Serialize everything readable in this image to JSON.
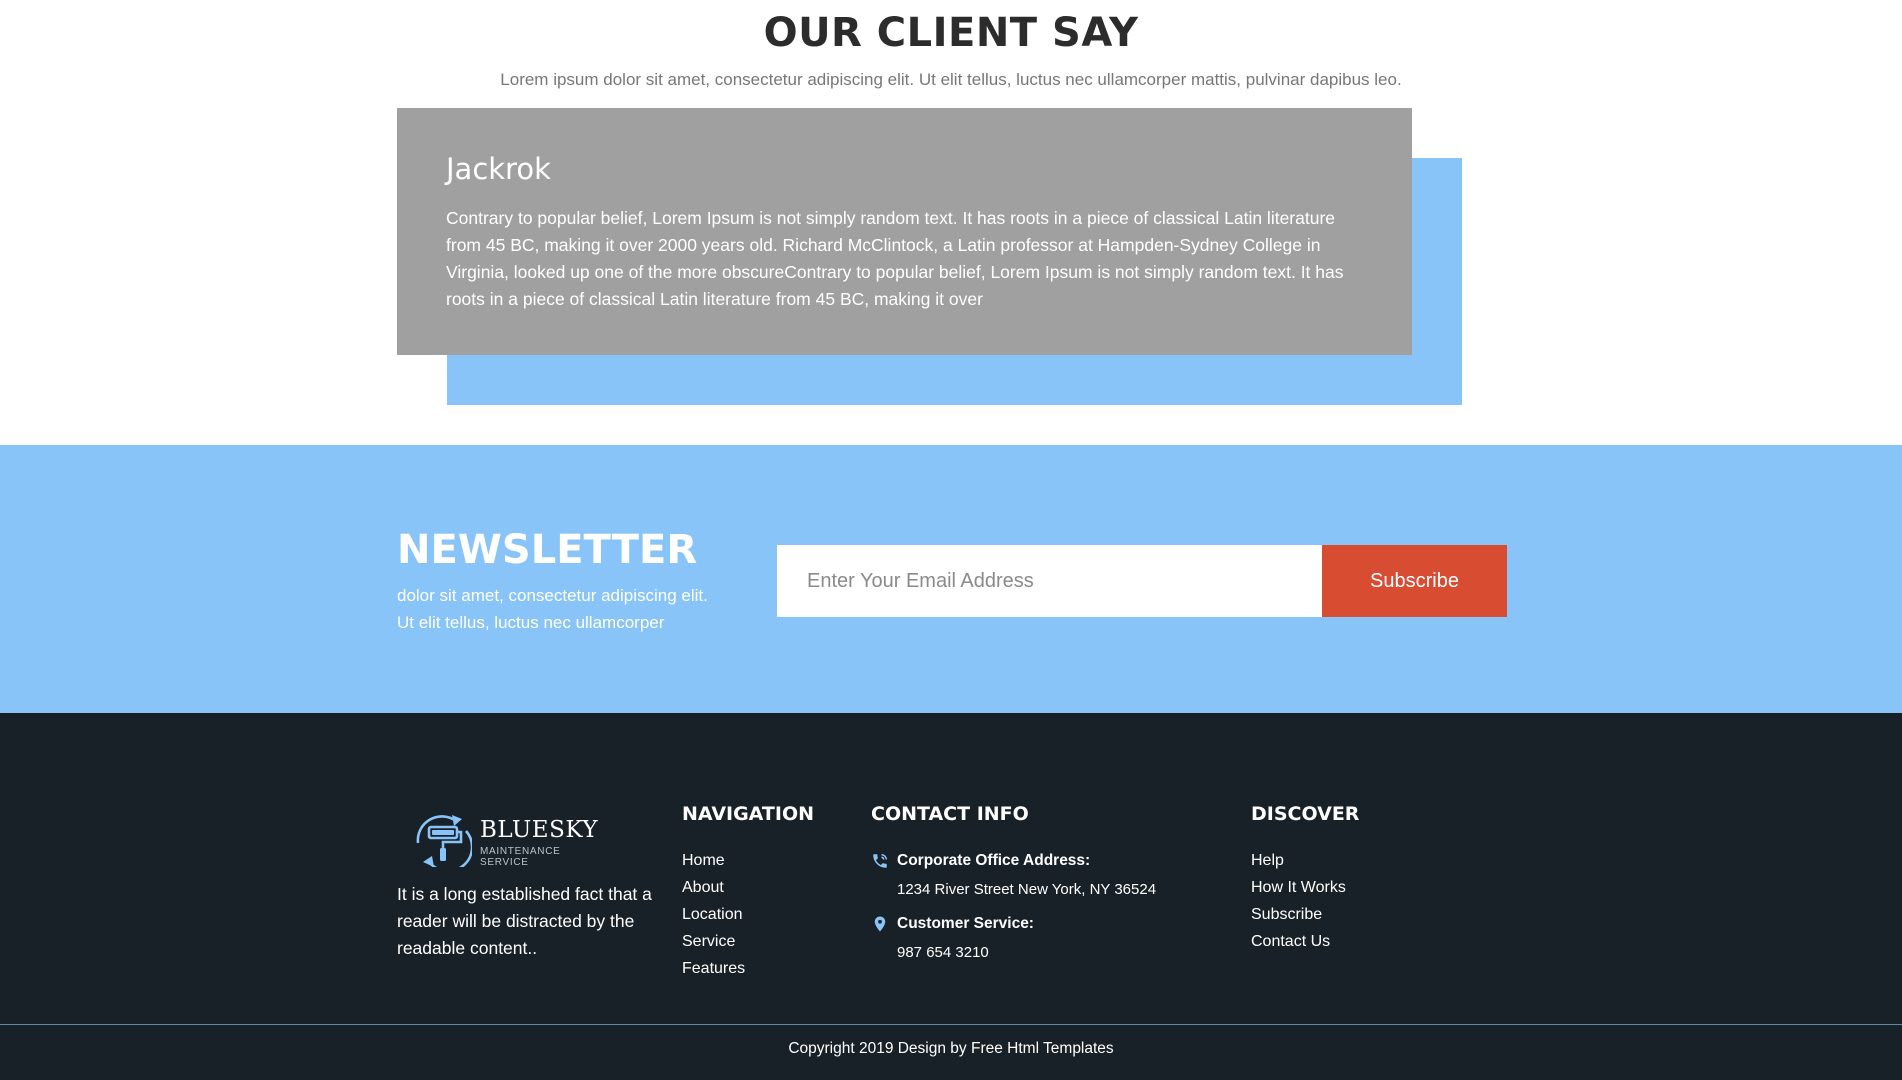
{
  "clients": {
    "title": "OUR CLIENT SAY",
    "subtitle": "Lorem ipsum dolor sit amet, consectetur adipiscing elit. Ut elit tellus, luctus nec ullamcorper mattis, pulvinar dapibus leo.",
    "testimonial": {
      "name": "Jackrok",
      "text": "Contrary to popular belief, Lorem Ipsum is not simply random text. It has roots in a piece of classical Latin literature from 45 BC, making it over 2000 years old. Richard McClintock, a Latin professor at Hampden-Sydney College in Virginia, looked up one of the more obscureContrary to popular belief, Lorem Ipsum is not simply random text. It has roots in a piece of classical Latin literature from 45 BC, making it over"
    }
  },
  "newsletter": {
    "title": "NEWSLETTER",
    "description": "dolor sit amet, consectetur adipiscing elit. Ut elit tellus, luctus nec ullamcorper",
    "email_placeholder": "Enter Your Email Address",
    "email_value": "",
    "subscribe_label": "Subscribe"
  },
  "footer": {
    "logo": {
      "name": "BLUESKY",
      "tagline": "MAINTENANCE SERVICE",
      "icon": "paint-roller-icon"
    },
    "about": "It is a long established fact that a reader will be distracted by the readable content..",
    "navigation": {
      "heading": "NAVIGATION",
      "items": [
        "Home",
        "About",
        "Location",
        "Service",
        "Features"
      ]
    },
    "contact": {
      "heading": "CONTACT INFO",
      "office_label": "Corporate Office Address:",
      "office_value": "1234 River Street New York, NY 36524",
      "office_icon": "phone-icon",
      "service_label": "Customer Service:",
      "service_value": "987 654 3210",
      "service_icon": "location-pin-icon"
    },
    "discover": {
      "heading": "DISCOVER",
      "items": [
        "Help",
        "How It Works",
        "Subscribe",
        "Contact Us"
      ]
    },
    "copyright": "Copyright 2019 Design by Free Html Templates"
  },
  "colors": {
    "accent_blue": "#89c4f8",
    "card_gray": "#a0a0a0",
    "button_red": "#d84c32",
    "footer_bg": "#182127"
  }
}
